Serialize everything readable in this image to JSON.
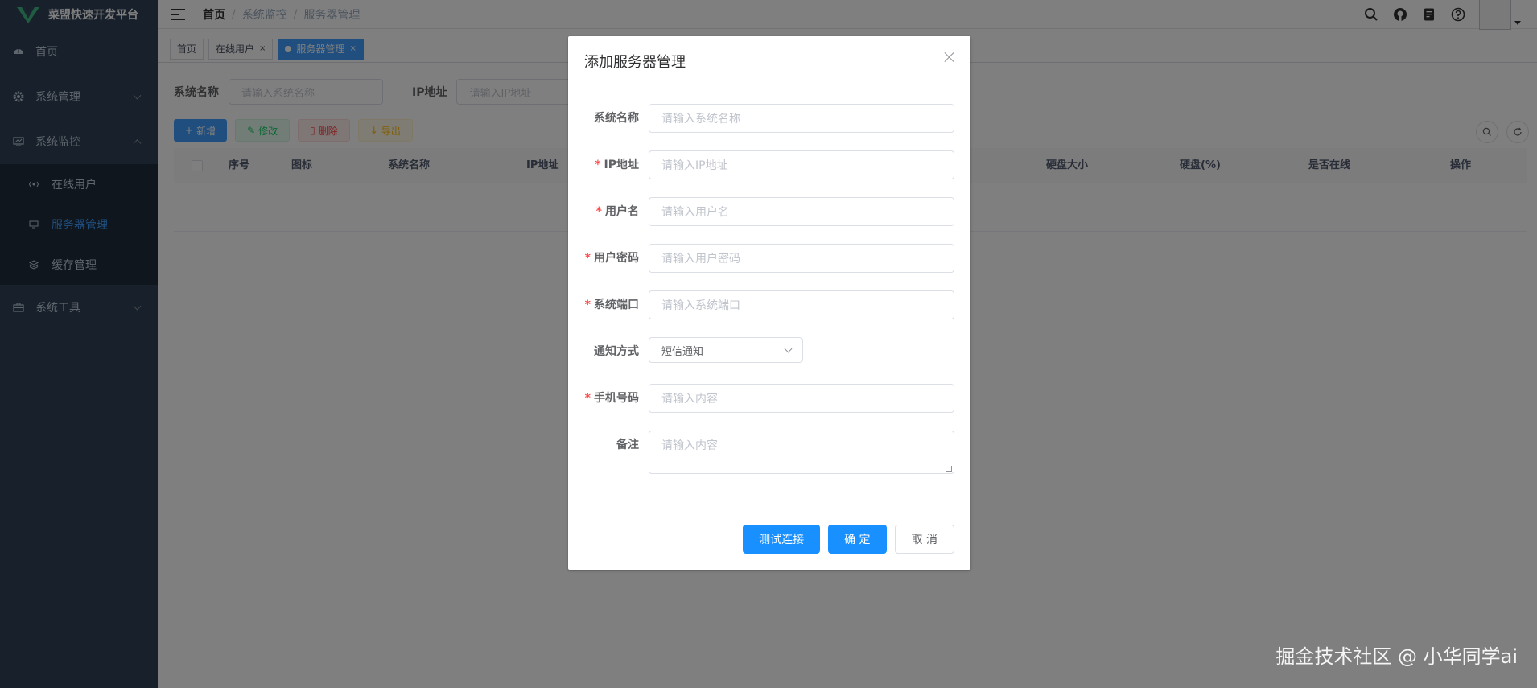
{
  "app": {
    "title": "菜盟快速开发平台"
  },
  "sidebar": {
    "items": [
      {
        "label": "首页"
      },
      {
        "label": "系统管理"
      },
      {
        "label": "系统监控"
      },
      {
        "label": "系统工具"
      }
    ],
    "submenu": [
      {
        "label": "在线用户"
      },
      {
        "label": "服务器管理"
      },
      {
        "label": "缓存管理"
      }
    ]
  },
  "breadcrumb": [
    "首页",
    "系统监控",
    "服务器管理"
  ],
  "tags": [
    {
      "label": "首页"
    },
    {
      "label": "在线用户"
    },
    {
      "label": "服务器管理"
    }
  ],
  "filter": {
    "name_label": "系统名称",
    "name_placeholder": "请输入系统名称",
    "ip_label": "IP地址",
    "ip_placeholder": "请输入IP地址"
  },
  "toolbar": {
    "add": "新增",
    "edit": "修改",
    "delete": "删除",
    "export": "导出"
  },
  "table": {
    "headers": [
      "序号",
      "图标",
      "系统名称",
      "IP地址",
      "硬盘大小",
      "硬盘(%)",
      "是否在线",
      "操作"
    ]
  },
  "dialog": {
    "title": "添加服务器管理",
    "fields": [
      {
        "label": "系统名称",
        "required": false,
        "placeholder": "请输入系统名称"
      },
      {
        "label": "IP地址",
        "required": true,
        "placeholder": "请输入IP地址"
      },
      {
        "label": "用户名",
        "required": true,
        "placeholder": "请输入用户名"
      },
      {
        "label": "用户密码",
        "required": true,
        "placeholder": "请输入用户密码"
      },
      {
        "label": "系统端口",
        "required": true,
        "placeholder": "请输入系统端口"
      }
    ],
    "notify": {
      "label": "通知方式",
      "value": "短信通知"
    },
    "phone": {
      "label": "手机号码",
      "required": true,
      "placeholder": "请输入内容"
    },
    "remark": {
      "label": "备注",
      "placeholder": "请输入内容"
    },
    "buttons": {
      "test": "测试连接",
      "ok": "确 定",
      "cancel": "取 消"
    }
  },
  "watermark": "掘金技术社区 @ 小华同学ai",
  "colors": {
    "primary": "#1890ff",
    "sidebar": "#304156",
    "required": "#ff4949"
  }
}
